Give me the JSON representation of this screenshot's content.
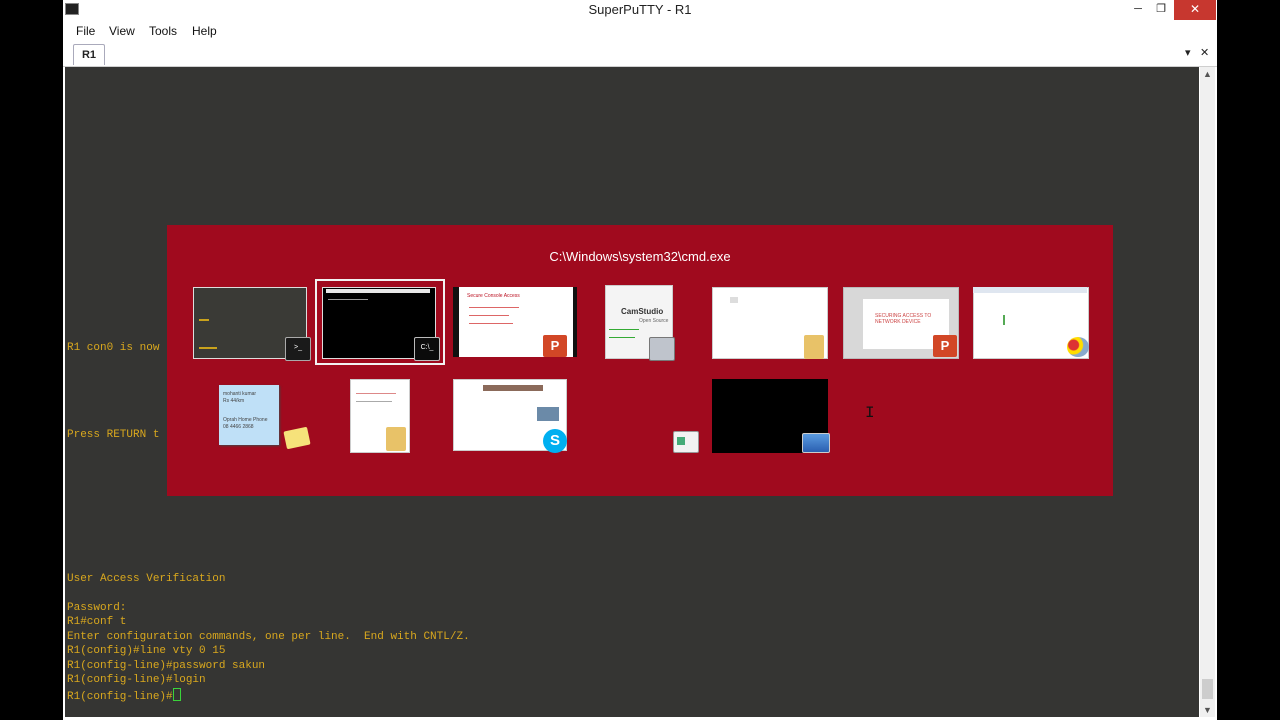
{
  "window": {
    "title": "SuperPuTTY - R1",
    "minimize_glyph": "─",
    "restore_glyph": "❐",
    "close_glyph": "✕"
  },
  "menu": [
    "File",
    "View",
    "Tools",
    "Help"
  ],
  "tabs": [
    {
      "label": "R1",
      "active": true
    }
  ],
  "tab_controls": {
    "dropdown_glyph": "▾",
    "close_glyph": "✕"
  },
  "terminal": {
    "text_color": "#d9a81e",
    "background": "#353533",
    "lines": [
      "R1 con0 is now",
      "Press RETURN t",
      "User Access Verification",
      "Password:",
      "R1#conf t",
      "Enter configuration commands, one per line.  End with CNTL/Z.",
      "R1(config)#line vty 0 15",
      "R1(config-line)#password sakun",
      "R1(config-line)#login",
      "R1(config-line)#"
    ]
  },
  "task_switcher": {
    "title": "C:\\Windows\\system32\\cmd.exe",
    "background": "#a00a1e",
    "selected_index": 1,
    "windows": [
      {
        "kind": "terminal",
        "icon": "terminal-icon"
      },
      {
        "kind": "cmd",
        "icon": "cmd-icon",
        "badge_text": "C:\\_"
      },
      {
        "kind": "presentation",
        "icon": "powerpoint-icon",
        "heading": "Secure Console Access",
        "badge_text": "P"
      },
      {
        "kind": "camstudio",
        "icon": "camstudio-icon",
        "heading": "CamStudio",
        "subheading": "Open Source"
      },
      {
        "kind": "explorer",
        "icon": "folder-icon"
      },
      {
        "kind": "presentation",
        "icon": "powerpoint-icon",
        "heading": "SECURING ACCESS TO NETWORK DEVICE",
        "badge_text": "P"
      },
      {
        "kind": "paint",
        "icon": "paint-icon"
      },
      {
        "kind": "sticky-notes",
        "icon": "sticky-notes-icon",
        "note_lines": [
          "mohanti kumar",
          "Rs 44/km",
          "Oprah Home Phone",
          "08 4466 2868"
        ]
      },
      {
        "kind": "explorer",
        "icon": "folder-icon"
      },
      {
        "kind": "skype",
        "icon": "skype-icon",
        "badge_text": "S"
      },
      {
        "kind": "app",
        "icon": "app-icon"
      },
      {
        "kind": "desktop",
        "icon": "desktop-icon"
      }
    ]
  },
  "scrollbar": {
    "up_glyph": "▲",
    "down_glyph": "▼"
  },
  "mouse_cursor": "I"
}
